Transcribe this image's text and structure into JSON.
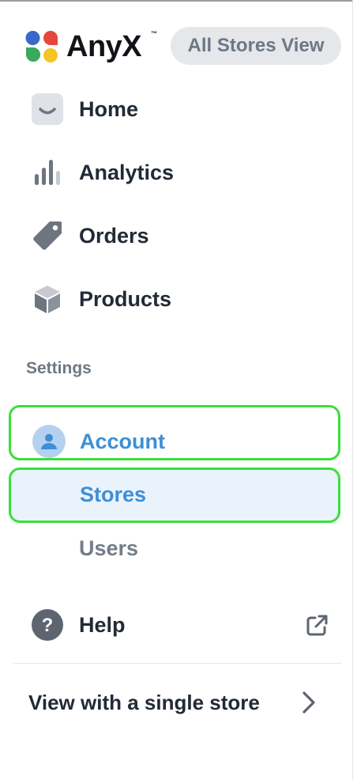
{
  "brand": {
    "name": "AnyX",
    "trademark": "™",
    "logo_colors": [
      "#3a68c9",
      "#e5463d",
      "#39a95b",
      "#f5c623"
    ]
  },
  "header": {
    "view_button_label": "All Stores View"
  },
  "nav": {
    "items": [
      {
        "label": "Home",
        "icon": "home-icon"
      },
      {
        "label": "Analytics",
        "icon": "bar-chart-icon"
      },
      {
        "label": "Orders",
        "icon": "tag-icon"
      },
      {
        "label": "Products",
        "icon": "box-icon"
      }
    ]
  },
  "settings": {
    "heading": "Settings",
    "account": {
      "label": "Account",
      "icon": "user-icon"
    },
    "sub_items": [
      {
        "label": "Stores",
        "active": true
      },
      {
        "label": "Users",
        "active": false
      }
    ]
  },
  "help": {
    "label": "Help",
    "icon": "question-icon",
    "external_icon": "external-link-icon"
  },
  "footer": {
    "single_store_label": "View with a single store",
    "icon": "chevron-right-icon"
  },
  "colors": {
    "accent": "#3d8fd6",
    "active_bg": "#eaf3fc",
    "highlight_border": "#3adf3a",
    "icon_gray": "#6d7580",
    "text_dark": "#222a35",
    "text_muted": "#747d89"
  }
}
